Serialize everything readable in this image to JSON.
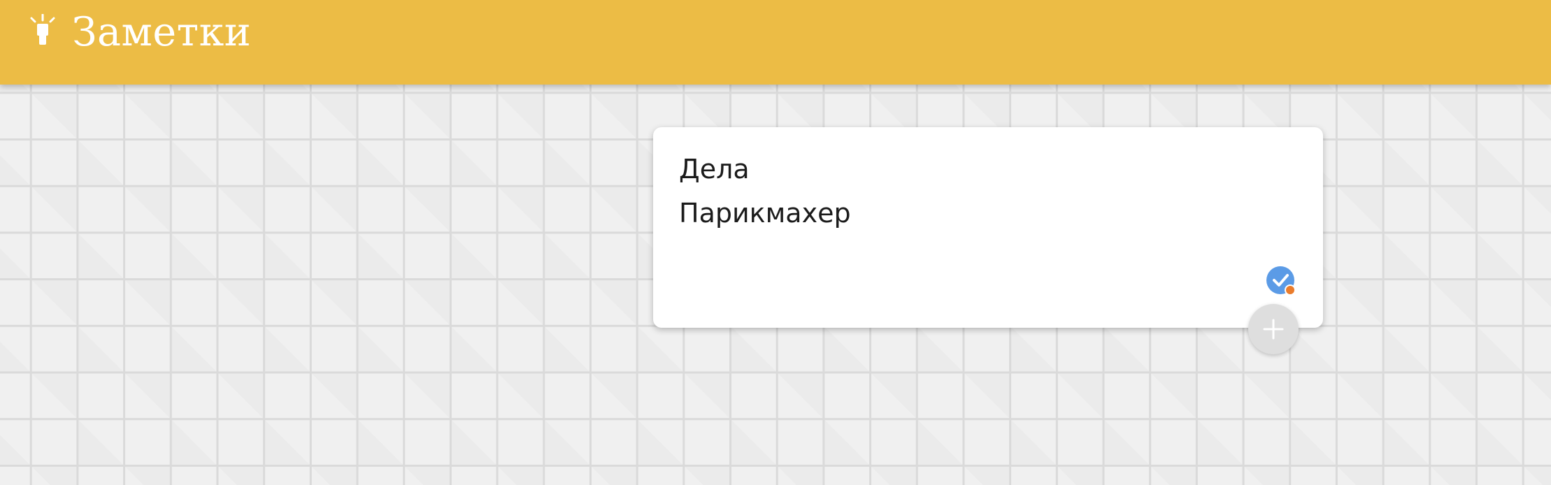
{
  "header": {
    "title": "Заметки",
    "icon": "lightbulb-icon",
    "background": "#ecbc45"
  },
  "note": {
    "title": "Дела",
    "body": "Парикмахер",
    "status_icon": "check-badge-icon",
    "status_color": "#5b9be6",
    "status_dot_color": "#ea7c2c"
  },
  "add_button": {
    "icon": "plus-icon"
  }
}
